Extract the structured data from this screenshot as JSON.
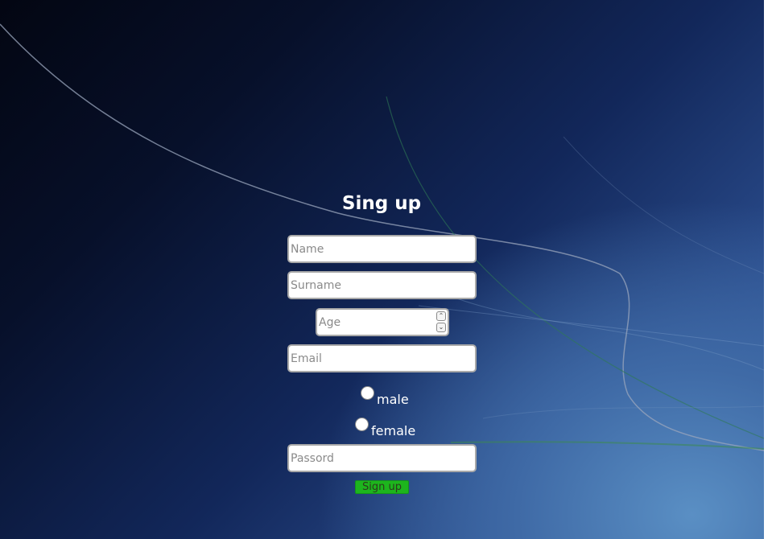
{
  "form": {
    "title": "Sing up",
    "name": {
      "placeholder": "Name",
      "value": ""
    },
    "surname": {
      "placeholder": "Surname",
      "value": ""
    },
    "age": {
      "placeholder": "Age",
      "value": ""
    },
    "email": {
      "placeholder": "Email",
      "value": ""
    },
    "gender": {
      "options": [
        {
          "label": "male",
          "checked": false
        },
        {
          "label": "female",
          "checked": false
        }
      ]
    },
    "password": {
      "placeholder": "Passord",
      "value": ""
    },
    "submit_label": "Sign up"
  },
  "icons": {
    "spin_up": "chevron-up-icon",
    "spin_down": "chevron-down-icon"
  },
  "colors": {
    "background_dark": "#030612",
    "background_light": "#3d6eae",
    "submit_button": "#1db51d",
    "title_text": "#ffffff"
  }
}
